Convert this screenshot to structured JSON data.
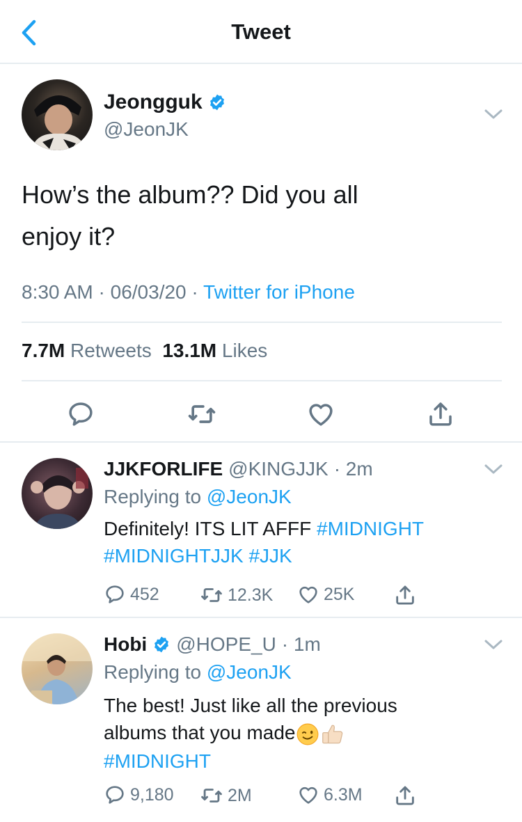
{
  "header": {
    "title": "Tweet",
    "back_icon": "chevron-left-icon"
  },
  "colors": {
    "accent": "#1da1f2",
    "secondary_text": "#657786",
    "divider": "#e6ecf0"
  },
  "tweet": {
    "author_name": "Jeongguk",
    "author_handle": "@JeonJK",
    "verified": true,
    "text_line1": "How’s the album?? Did you all",
    "text_line2": "enjoy it?",
    "time": "8:30 AM",
    "date": "06/03/20",
    "sep": "·",
    "source": "Twitter for iPhone",
    "retweets_count": "7.7M",
    "retweets_label": "Retweets",
    "likes_count": "13.1M",
    "likes_label": "Likes"
  },
  "replies": [
    {
      "name": "JJKFORLIFE",
      "handle": "@KINGJJK",
      "time": "· 2m",
      "replying_prefix": "Replying to",
      "replying_to": "@JeonJK",
      "text": "Definitely! ITS LIT AFFF",
      "hashtags": [
        "#MIDNIGHT",
        "#MIDNIGHTJJK",
        "#JJK"
      ],
      "reply_count": "452",
      "retweet_count": "12.3K",
      "like_count": "25K"
    },
    {
      "name": "Hobi",
      "handle": "@HOPE_U",
      "time": "· 1m",
      "verified": true,
      "replying_prefix": "Replying to",
      "replying_to": "@JeonJK",
      "text_line1": "The best! Just like all the previous",
      "text_line2": "albums that you made",
      "emojis": [
        "winking-face-emoji",
        "thumbs-up-emoji"
      ],
      "hashtags": [
        "#MIDNIGHT"
      ],
      "reply_count": "9,180",
      "retweet_count": "2M",
      "like_count": "6.3M"
    }
  ]
}
